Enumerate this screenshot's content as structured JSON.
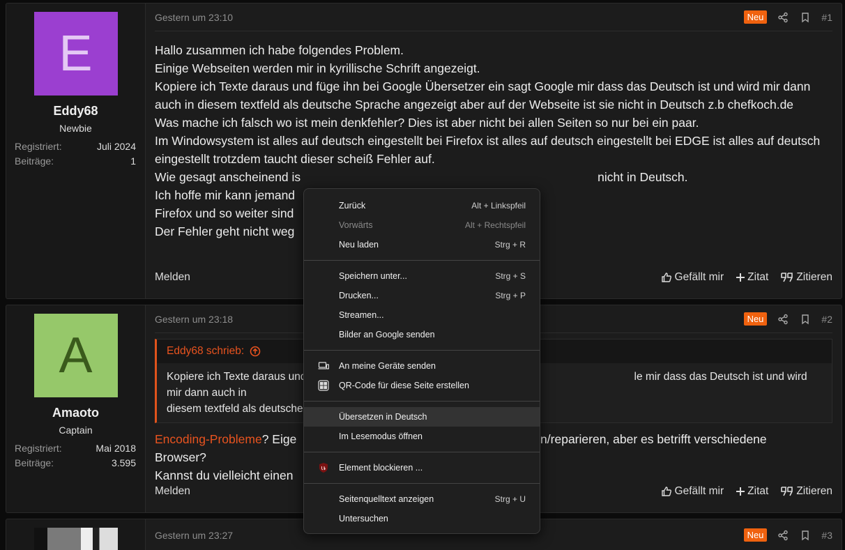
{
  "posts": [
    {
      "avatar_letter": "E",
      "username": "Eddy68",
      "usertitle": "Newbie",
      "registered_label": "Registriert:",
      "registered_value": "Juli 2024",
      "posts_label": "Beiträge:",
      "posts_value": "1",
      "date": "Gestern um 23:10",
      "badge": "Neu",
      "number": "#1",
      "body": [
        "Hallo zusammen ich habe folgendes Problem.",
        "Einige Webseiten werden mir in kyrillische Schrift angezeigt.",
        "Kopiere ich Texte daraus und füge ihn bei Google Übersetzer ein sagt Google mir dass das Deutsch ist und wird mir dann auch in diesem textfeld als deutsche Sprache angezeigt aber auf der Webseite ist sie nicht in Deutsch z.b chefkoch.de",
        "Was mache ich falsch wo ist mein denkfehler? Dies ist aber nicht bei allen Seiten so nur bei ein paar.",
        "Im Windowsystem ist alles auf deutsch eingestellt bei Firefox ist alles auf deutsch eingestellt bei EDGE ist alles auf deutsch eingestellt trotzdem taucht dieser scheiß Fehler auf.",
        "Wie gesagt anscheinend is",
        "nicht in Deutsch.",
        "Ich hoffe mir kann jemand",
        "Firefox und so weiter sind",
        "Der Fehler geht nicht weg"
      ],
      "report": "Melden",
      "like": "Gefällt mir",
      "quote": "Zitat",
      "cite": "Zitieren"
    },
    {
      "avatar_letter": "A",
      "username": "Amaoto",
      "usertitle": "Captain",
      "registered_label": "Registriert:",
      "registered_value": "Mai 2018",
      "posts_label": "Beiträge:",
      "posts_value": "3.595",
      "date": "Gestern um 23:18",
      "badge": "Neu",
      "number": "#2",
      "quote_author": "Eddy68 schrieb:",
      "quote_text_1": "Kopiere ich Texte daraus und",
      "quote_text_2": "le mir dass das Deutsch ist und wird mir dann auch in",
      "quote_text_3": "diesem textfeld als deutsche",
      "body_link": "Encoding-Probleme",
      "body_1": "? Eige",
      "body_2": "en/reparieren, aber es betrifft verschiedene",
      "body_3": "Browser?",
      "body_4": "Kannst du vielleicht einen",
      "report": "Melden",
      "like": "Gefällt mir",
      "quote": "Zitat",
      "cite": "Zitieren"
    },
    {
      "date": "Gestern um 23:27",
      "badge": "Neu",
      "number": "#3"
    }
  ],
  "context_menu": {
    "back": {
      "label": "Zurück",
      "shortcut": "Alt + Linkspfeil"
    },
    "forward": {
      "label": "Vorwärts",
      "shortcut": "Alt + Rechtspfeil"
    },
    "reload": {
      "label": "Neu laden",
      "shortcut": "Strg + R"
    },
    "save_as": {
      "label": "Speichern unter...",
      "shortcut": "Strg + S"
    },
    "print": {
      "label": "Drucken...",
      "shortcut": "Strg + P"
    },
    "cast": {
      "label": "Streamen..."
    },
    "google_images": {
      "label": "Bilder an Google senden"
    },
    "send_devices": {
      "label": "An meine Geräte senden"
    },
    "qr_code": {
      "label": "QR-Code für diese Seite erstellen"
    },
    "translate": {
      "label": "Übersetzen in Deutsch"
    },
    "reader_mode": {
      "label": "Im Lesemodus öffnen"
    },
    "block_element": {
      "label": "Element blockieren ..."
    },
    "view_source": {
      "label": "Seitenquelltext anzeigen",
      "shortcut": "Strg + U"
    },
    "inspect": {
      "label": "Untersuchen"
    }
  },
  "colors": {
    "accent": "#f0620f",
    "quote_accent": "#e8531f",
    "avatar_e": "#9b3fd0",
    "avatar_a": "#96c86a"
  }
}
